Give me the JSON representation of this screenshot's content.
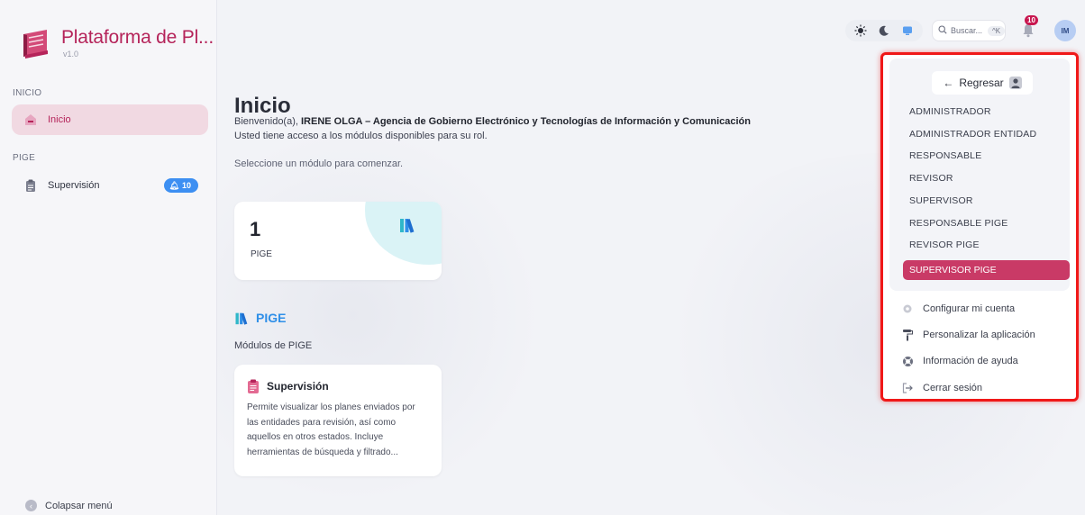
{
  "brand": {
    "title": "Plataforma de Pl...",
    "version": "v1.0"
  },
  "sidebar": {
    "sections": [
      {
        "label": "INICIO",
        "items": [
          {
            "label": "Inicio",
            "icon": "house-icon",
            "active": true
          }
        ]
      },
      {
        "label": "PIGE",
        "items": [
          {
            "label": "Supervisión",
            "icon": "clipboard-icon",
            "badge": "10"
          }
        ]
      }
    ],
    "collapse_label": "Colapsar menú"
  },
  "topbar": {
    "search_placeholder": "Buscar...",
    "search_shortcut": "^K",
    "notifications_count": "10",
    "avatar_initials": "IM"
  },
  "main": {
    "title": "Inicio",
    "welcome_prefix": "Bienvenido(a), ",
    "user_name": "IRENE OLGA",
    "welcome_separator": " – ",
    "agency": "Agencia de Gobierno Electrónico y Tecnologías de Información y Comunicación",
    "access_text": "Usted tiene acceso a los módulos disponibles para su rol.",
    "select_text": "Seleccione un módulo para comenzar.",
    "stat_card": {
      "value": "1",
      "label": "PIGE"
    },
    "module_section": {
      "title": "PIGE",
      "subtitle": "Módulos de PIGE"
    },
    "module_card": {
      "title": "Supervisión",
      "description": "Permite visualizar los planes enviados por las entidades para revisión, así como aquellos en otros estados. Incluye herramientas de búsqueda y filtrado..."
    }
  },
  "dropdown": {
    "back_label": "Regresar",
    "roles": [
      "ADMINISTRADOR",
      "ADMINISTRADOR ENTIDAD",
      "RESPONSABLE",
      "REVISOR",
      "SUPERVISOR",
      "RESPONSABLE PIGE",
      "REVISOR PIGE",
      "SUPERVISOR PIGE"
    ],
    "menu": [
      {
        "label": "Configurar mi cuenta",
        "icon": "gear-icon"
      },
      {
        "label": "Personalizar la aplicación",
        "icon": "paint-roller-icon"
      },
      {
        "label": "Información de ayuda",
        "icon": "lifebuoy-icon"
      },
      {
        "label": "Cerrar sesión",
        "icon": "logout-icon"
      }
    ]
  },
  "colors": {
    "brand": "#b5245a",
    "accent_blue": "#2f8fe8",
    "active_role": "#c93a66"
  }
}
